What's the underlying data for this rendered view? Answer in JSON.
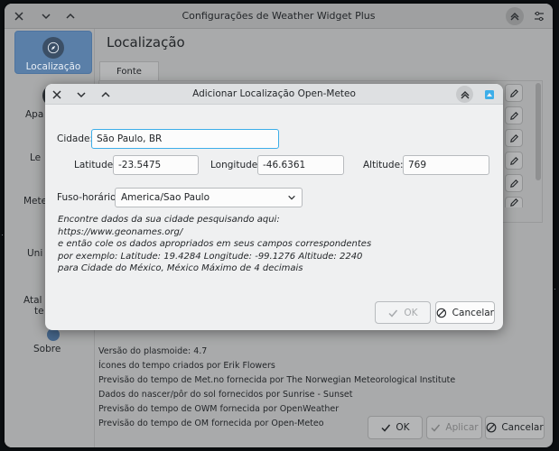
{
  "main_window": {
    "title": "Configurações de Weather Widget Plus",
    "page_title": "Localização",
    "tab_label": "Fonte"
  },
  "sidebar": {
    "items": [
      {
        "label": "Localização"
      },
      {
        "label": "Apa"
      },
      {
        "label": "Le"
      },
      {
        "label": "Mete"
      },
      {
        "label": "Uni"
      },
      {
        "label": "Atal"
      },
      {
        "label": "te"
      },
      {
        "label": "Sobre"
      }
    ]
  },
  "info_lines": [
    "Versão do plasmoide: 4.7",
    "Ícones do tempo criados por Erik Flowers",
    "Previsão do tempo de Met.no fornecida por The Norwegian Meteorological Institute",
    "Dados do nascer/pôr do sol fornecidos por Sunrise - Sunset",
    "Previsão do tempo de OWM fornecida por OpenWeather",
    "Previsão do tempo de OM fornecida por Open-Meteo"
  ],
  "main_buttons": {
    "ok": "OK",
    "apply": "Aplicar",
    "cancel": "Cancelar"
  },
  "dialog": {
    "title": "Adicionar Localização Open-Meteo",
    "city_label": "Cidade:",
    "city_value": "São Paulo, BR",
    "latitude_label": "Latitude:",
    "latitude_value": "-23.5475",
    "longitude_label": "Longitude:",
    "longitude_value": "-46.6361",
    "altitude_label": "Altitude:",
    "altitude_value": "769",
    "timezone_label": "Fuso-horário:",
    "timezone_value": "America/Sao Paulo",
    "help_lines": [
      "Encontre dados da sua cidade pesquisando aqui:",
      "https://www.geonames.org/",
      "e então cole os dados apropriados em seus campos correspondentes",
      "por exemplo: Latitude: 19.4284 Longitude: -99.1276 Altitude: 2240",
      "para Cidade do México, México Máximo de 4 decimais"
    ],
    "ok_label": "OK",
    "cancel_label": "Cancelar"
  },
  "colors": {
    "accent": "#3daee9",
    "sidebar_active": "#5a7fa8"
  }
}
